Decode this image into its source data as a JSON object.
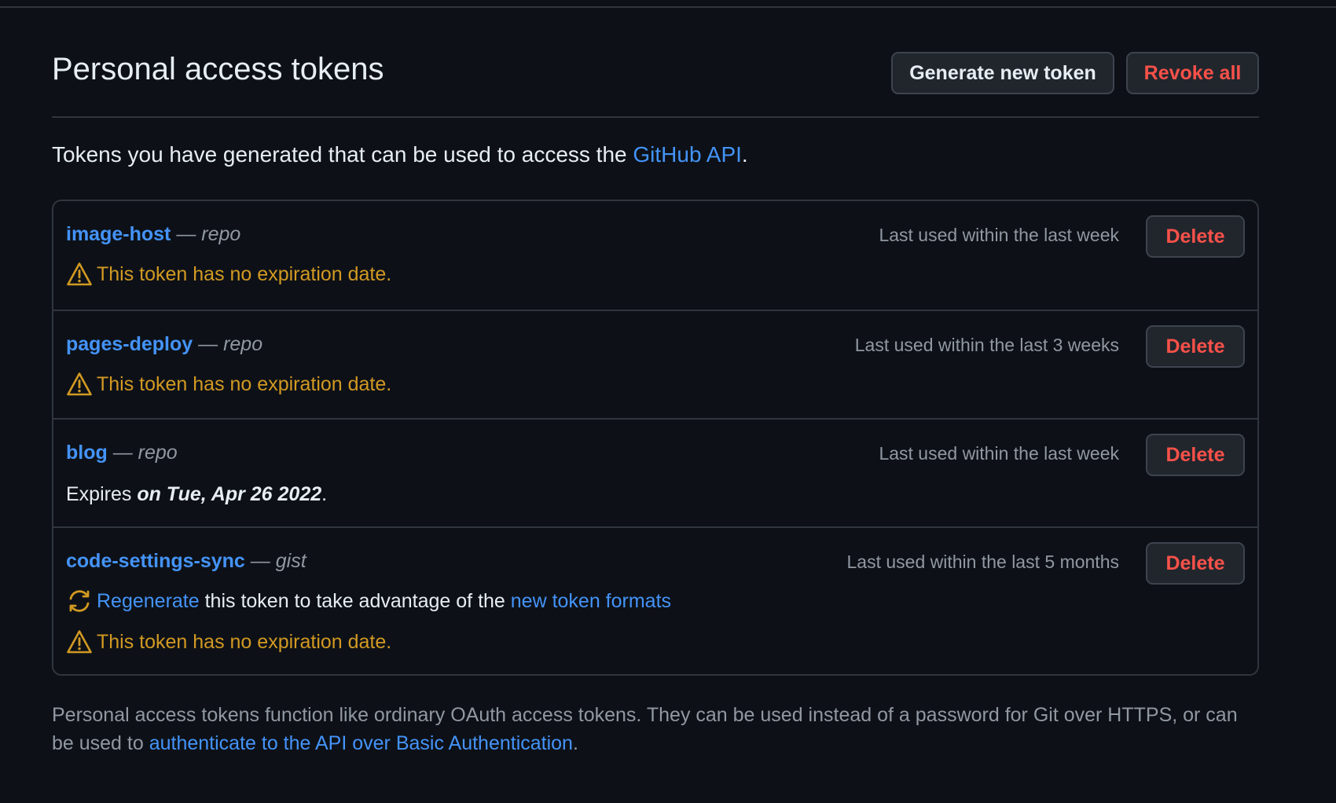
{
  "header": {
    "title": "Personal access tokens",
    "generate_label": "Generate new token",
    "revoke_label": "Revoke all"
  },
  "intro": {
    "text": "Tokens you have generated that can be used to access the ",
    "link": "GitHub API",
    "end": "."
  },
  "tokens": [
    {
      "name": "image-host",
      "dash": "—",
      "scope": "repo",
      "last_used": "Last used within the last week",
      "delete_label": "Delete",
      "warning": "This token has no expiration date."
    },
    {
      "name": "pages-deploy",
      "dash": "—",
      "scope": "repo",
      "last_used": "Last used within the last 3 weeks",
      "delete_label": "Delete",
      "warning": "This token has no expiration date."
    },
    {
      "name": "blog",
      "dash": "—",
      "scope": "repo",
      "last_used": "Last used within the last week",
      "delete_label": "Delete",
      "expires_prefix": "Expires ",
      "expires_date": "on Tue, Apr 26 2022",
      "expires_end": "."
    },
    {
      "name": "code-settings-sync",
      "dash": "—",
      "scope": "gist",
      "last_used": "Last used within the last 5 months",
      "delete_label": "Delete",
      "regenerate_link": "Regenerate",
      "regenerate_text": " this token to take advantage of the ",
      "formats_link": "new token formats",
      "warning": "This token has no expiration date."
    }
  ],
  "footer": {
    "text": "Personal access tokens function like ordinary OAuth access tokens. They can be used instead of a password for Git over HTTPS, or can be used to ",
    "link": "authenticate to the API over Basic Authentication",
    "end": "."
  },
  "icons": {
    "warning": "alert-triangle-icon",
    "regenerate": "sync-icon"
  },
  "colors": {
    "background": "#0d1117",
    "link": "#4493f8",
    "danger": "#f85149",
    "warning": "#d29922",
    "muted": "#9198a1",
    "border": "#30363d"
  }
}
